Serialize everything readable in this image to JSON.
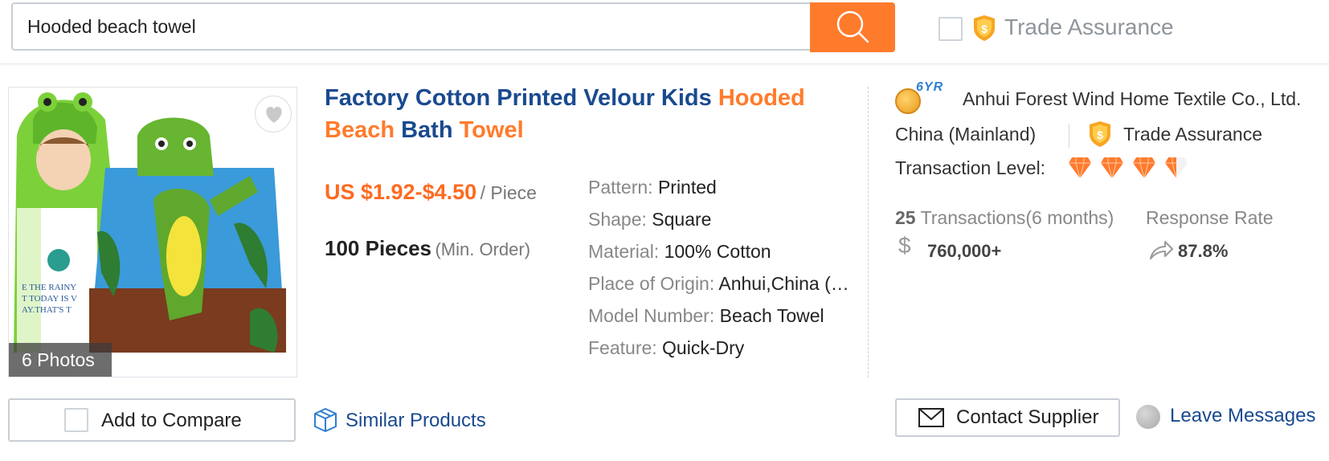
{
  "search": {
    "query": "Hooded beach towel",
    "trade_assurance_label": "Trade Assurance",
    "search_icon": "magnifier-icon"
  },
  "product": {
    "photos_label": "6 Photos",
    "title_parts": [
      {
        "text": "Factory Cotton Printed Velour Kids ",
        "highlight": false
      },
      {
        "text": "Hooded",
        "highlight": true
      },
      {
        "text": " ",
        "highlight": false
      },
      {
        "text": "Beach",
        "highlight": true
      },
      {
        "text": " Bath ",
        "highlight": false
      },
      {
        "text": "Towel",
        "highlight": true
      }
    ],
    "price": "US $1.92-$4.50",
    "price_unit": "/ Piece",
    "min_order_qty": "100 Pieces",
    "min_order_label": "(Min. Order)",
    "attributes": [
      {
        "key": "Pattern:",
        "value": "Printed"
      },
      {
        "key": "Shape:",
        "value": "Square"
      },
      {
        "key": "Material:",
        "value": "100% Cotton"
      },
      {
        "key": "Place of Origin:",
        "value": "Anhui,China (Mainland)"
      },
      {
        "key": "Model Number:",
        "value": "Beach Towel"
      },
      {
        "key": "Feature:",
        "value": "Quick-Dry"
      }
    ]
  },
  "supplier": {
    "years_badge": "6YR",
    "company": "Anhui Forest Wind Home Textile Co., Ltd.",
    "country": "China (Mainland)",
    "trade_assurance_label": "Trade Assurance",
    "transaction_level_label": "Transaction Level:",
    "transaction_level": 3.5,
    "transactions_count": "25",
    "transactions_label": "Transactions(6 months)",
    "response_rate_label": "Response Rate",
    "volume": "760,000+",
    "response_rate": "87.8%"
  },
  "actions": {
    "compare_label": "Add to Compare",
    "similar_label": "Similar Products",
    "contact_label": "Contact Supplier",
    "leave_messages_label": "Leave Messages"
  },
  "colors": {
    "accent_orange": "#ff7b2c",
    "title_blue": "#1a4a8f",
    "price_orange": "#ff6a1f",
    "diamond": "#ff7a2b"
  }
}
